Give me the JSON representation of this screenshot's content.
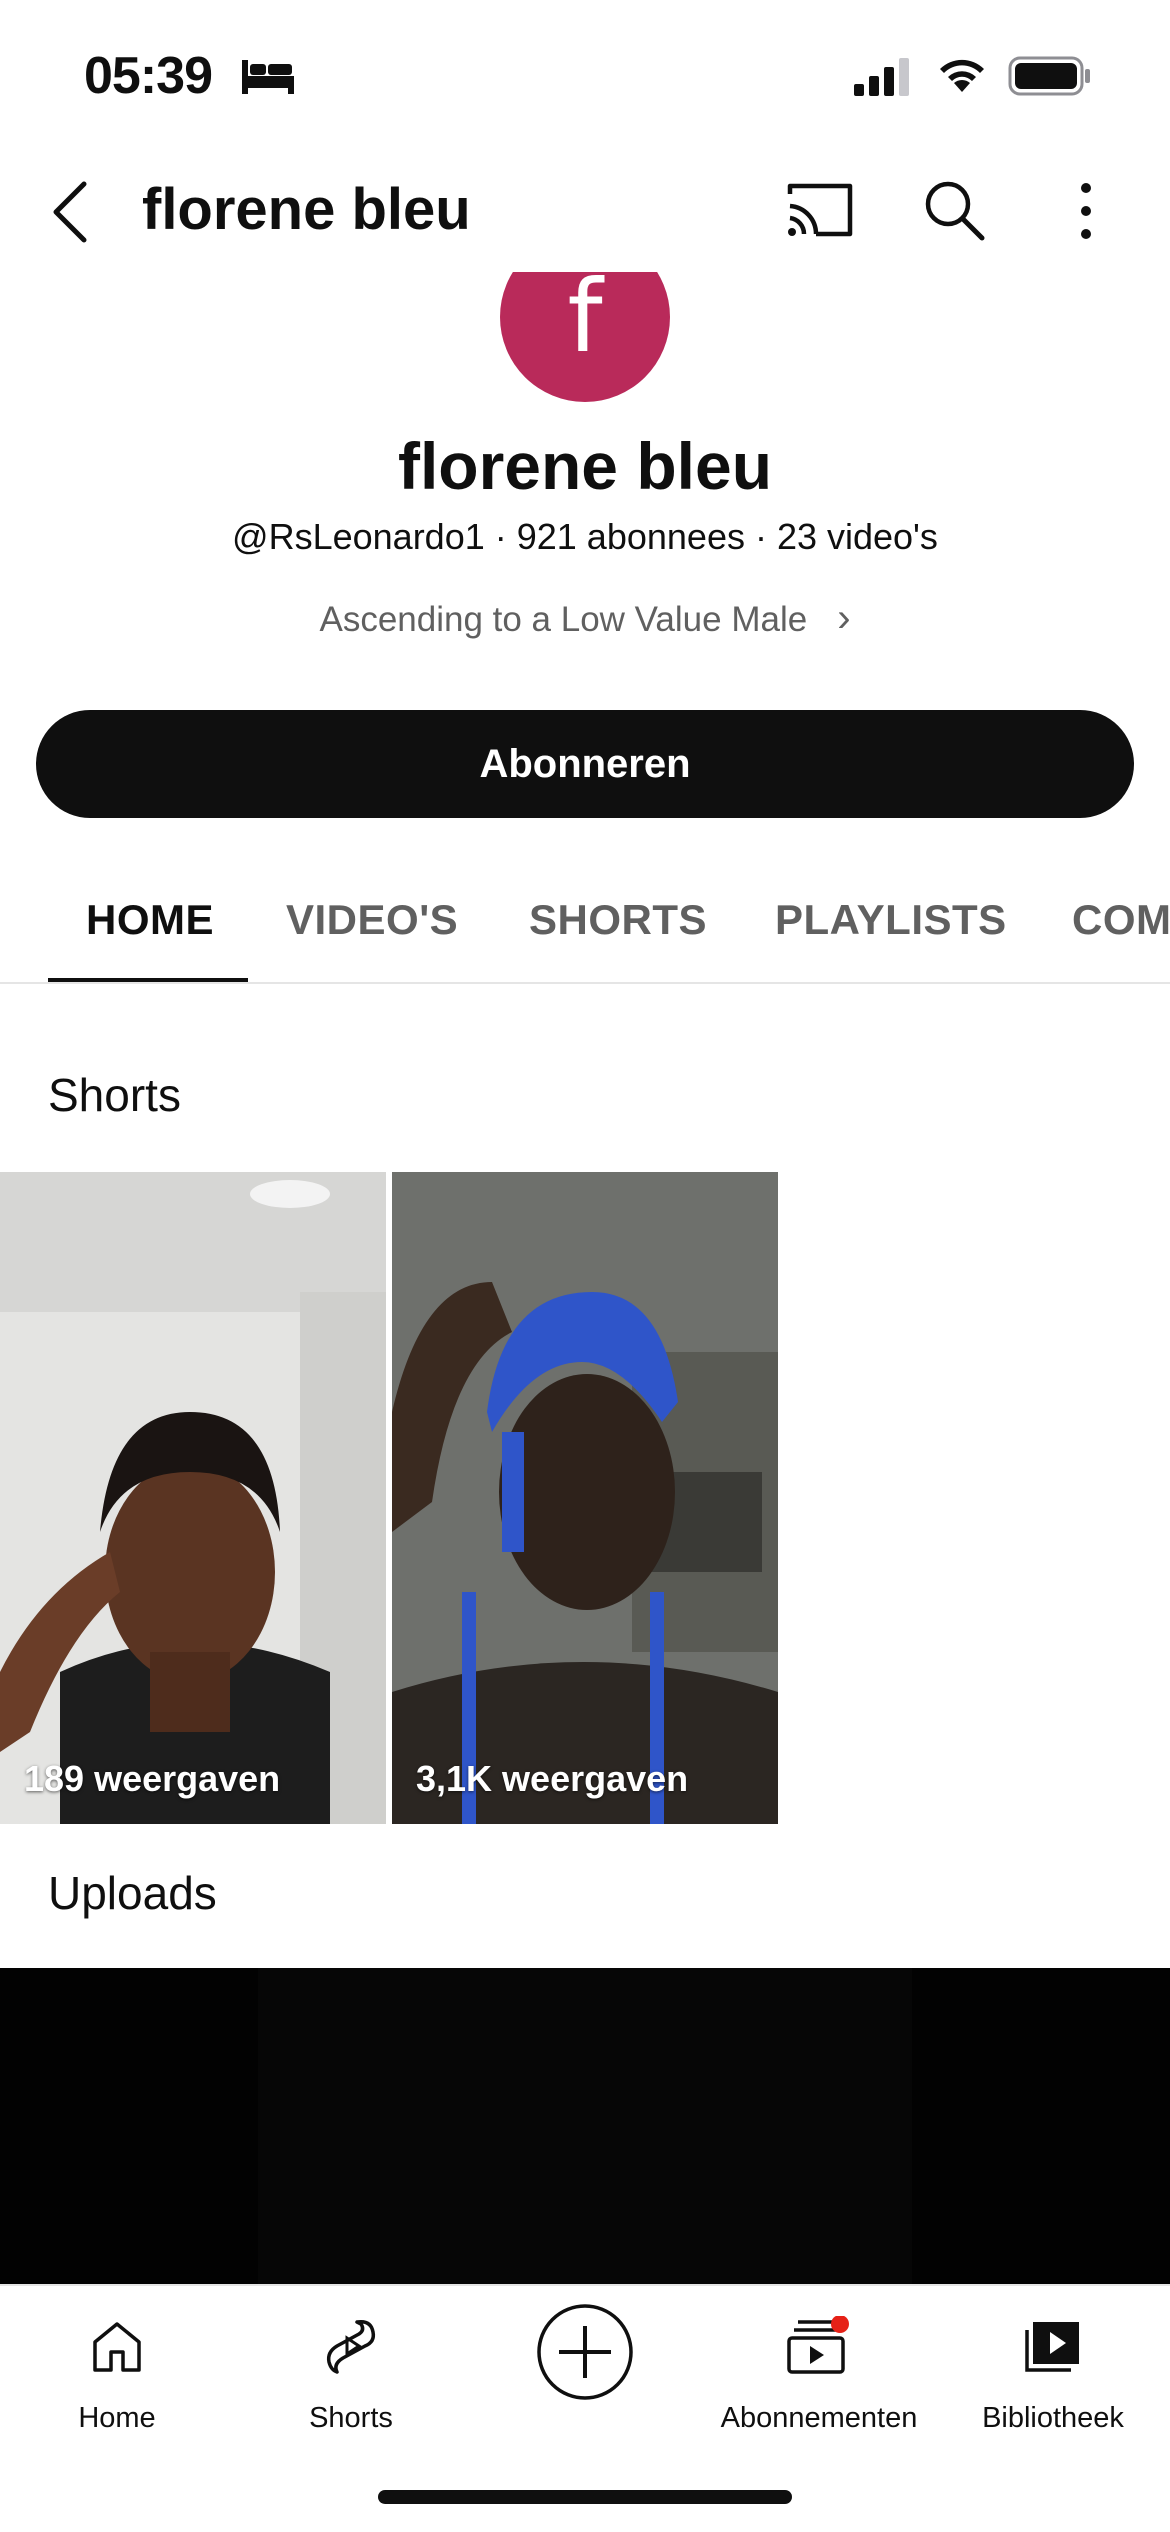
{
  "status_bar": {
    "time": "05:39",
    "icons": [
      "bed-icon",
      "signal-icon",
      "wifi-icon",
      "battery-icon"
    ]
  },
  "header": {
    "title": "florene bleu",
    "icons": [
      "back-icon",
      "cast-icon",
      "search-icon",
      "more-vert-icon"
    ]
  },
  "channel": {
    "avatar_letter": "f",
    "avatar_color": "#b92a5a",
    "name": "florene bleu",
    "meta": "@RsLeonardo1 · 921 abonnees · 23 video's",
    "description": "Ascending to a Low Value Male",
    "subscribe_label": "Abonneren"
  },
  "tabs": [
    {
      "label": "HOME",
      "active": true
    },
    {
      "label": "VIDEO'S",
      "active": false
    },
    {
      "label": "SHORTS",
      "active": false
    },
    {
      "label": "PLAYLISTS",
      "active": false
    },
    {
      "label": "COM",
      "active": false
    }
  ],
  "sections": {
    "shorts_title": "Shorts",
    "uploads_title": "Uploads"
  },
  "shorts": [
    {
      "views": "189 weergaven"
    },
    {
      "views": "3,1K weergaven"
    }
  ],
  "bottom_nav": [
    {
      "label": "Home",
      "icon": "home-icon"
    },
    {
      "label": "Shorts",
      "icon": "shorts-icon"
    },
    {
      "label": "",
      "icon": "create-plus-icon"
    },
    {
      "label": "Abonnementen",
      "icon": "subscriptions-icon",
      "badge": true
    },
    {
      "label": "Bibliotheek",
      "icon": "library-icon"
    }
  ],
  "colors": {
    "accent_red": "#e62117",
    "primary_text": "#0f0f0f",
    "secondary_text": "#606060"
  }
}
